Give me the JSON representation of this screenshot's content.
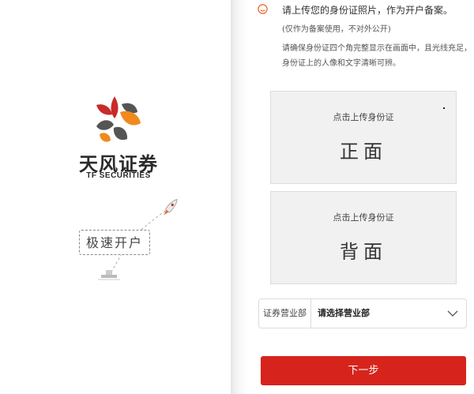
{
  "brand": {
    "name_cn": "天风证券",
    "name_en": "TF SECURITIES",
    "slogan": "极速开户"
  },
  "icons": {
    "logo": "tf-securities-logo",
    "notice": "smiley-icon",
    "rocket": "rocket-icon",
    "launchpad": "launchpad-icon",
    "dropdown": "chevron-down-icon"
  },
  "colors": {
    "accent": "#d6241c",
    "logo_red": "#c92a2a",
    "logo_orange": "#f08a1c",
    "logo_dark": "#555555",
    "notice_icon": "#e8642a"
  },
  "notice": {
    "title": "请上传您的身份证照片，作为开户备案。",
    "subtitle": "(仅作为备案使用，不对外公开)",
    "description": "请确保身份证四个角完整显示在画面中，且光线充足，身份证上的人像和文字清晰可辨。"
  },
  "upload": {
    "front": {
      "hint": "点击上传身份证",
      "side": "正面"
    },
    "back": {
      "hint": "点击上传身份证",
      "side": "背面"
    }
  },
  "branch": {
    "label": "证券营业部",
    "placeholder": "请选择营业部"
  },
  "next_button": "下一步"
}
